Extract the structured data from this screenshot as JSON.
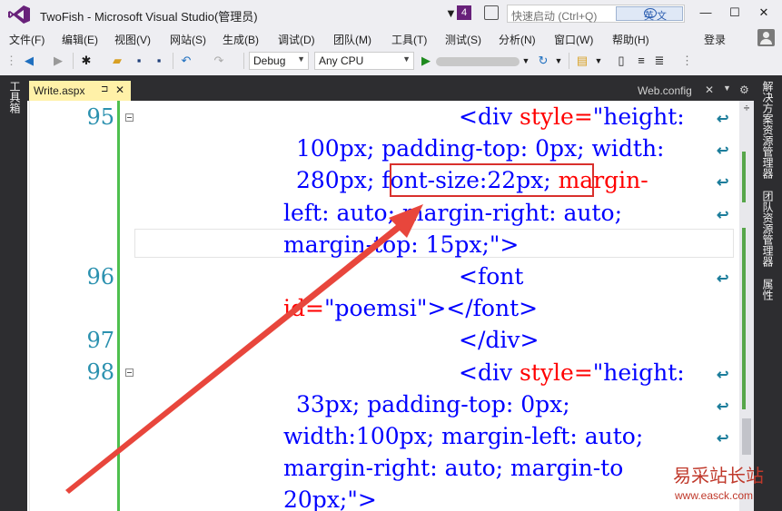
{
  "window": {
    "title": "TwoFish - Microsoft Visual Studio(管理员)",
    "notification_count": "4",
    "quick_launch_placeholder": "快速启动 (Ctrl+Q)",
    "ime_label": "英 文"
  },
  "menu": {
    "items": [
      "文件(F)",
      "编辑(E)",
      "视图(V)",
      "网站(S)",
      "生成(B)",
      "调试(D)",
      "团队(M)",
      "工具(T)",
      "测试(S)",
      "分析(N)",
      "窗口(W)",
      "帮助(H)"
    ],
    "signin": "登录"
  },
  "toolbar": {
    "config": "Debug",
    "platform": "Any CPU"
  },
  "side": {
    "left_label": "工具箱",
    "right_labels": [
      "解决方案资源管理器",
      "团队资源管理器",
      "属性"
    ]
  },
  "tabs": {
    "active": "Write.aspx",
    "active_pin": "⊐",
    "right": "Web.config"
  },
  "editor": {
    "line_numbers": [
      "95",
      "96",
      "97",
      "98"
    ],
    "lines": {
      "l1_tag": "<div",
      "l1_attr": " style=",
      "l1_val": "\"height:",
      "l2": "100px; padding-top: 0px; width:",
      "l3a": "280px; ",
      "l3b": "font-size:22px;",
      "l3c": " margin-",
      "l4": "left: auto; margin-right: auto;",
      "l5a": "margin-top: 15px;",
      "l5b": "\">",
      "l6": "<font",
      "l7a": "id=",
      "l7b": "\"poemsi\"",
      "l7c": "></font>",
      "l8": "</div>",
      "l9_tag": "<div",
      "l9_attr": " style=",
      "l9_val": "\"height:",
      "l10": "33px; padding-top: 0px;",
      "l11": "width:100px; margin-left: auto;",
      "l12": "margin-right: auto; margin-to",
      "l13a": "20px;",
      "l13b": "\">"
    }
  },
  "watermark": {
    "cn": "易采站长站",
    "url": "www.easck.com"
  },
  "colors": {
    "accent": "#68217a",
    "tab_active": "#fff1a8",
    "highlight": "#d9302c",
    "change_bar": "#57a64a"
  }
}
